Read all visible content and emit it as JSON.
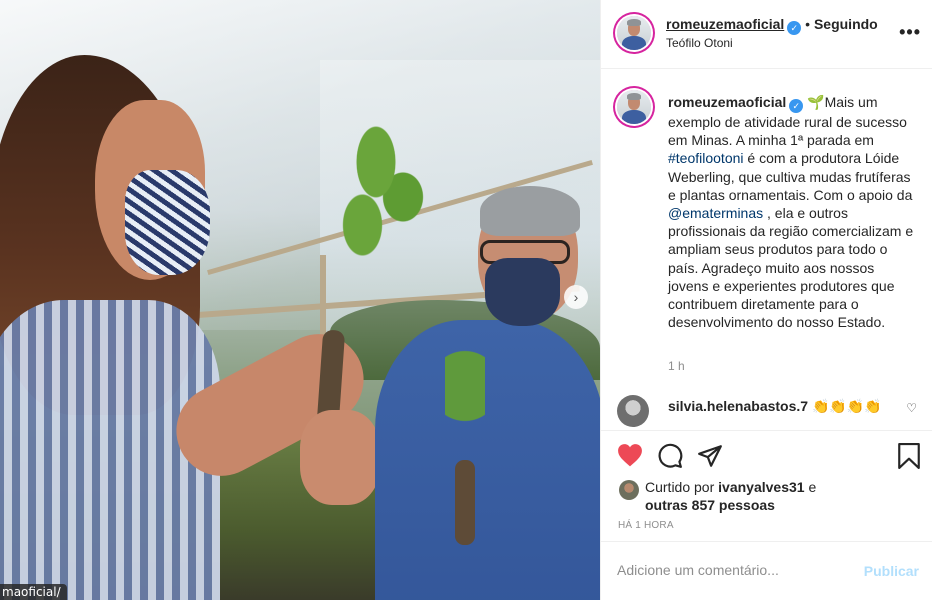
{
  "photo": {
    "url_overlay": "maoficial/"
  },
  "header": {
    "username": "romeuzemaoficial",
    "separator": "•",
    "following": "Seguindo",
    "location": "Teófilo Otoni",
    "more_icon": "more-horizontal-icon"
  },
  "caption": {
    "username": "romeuzemaoficial",
    "emoji": "🌱",
    "text_1": "Mais um exemplo de atividade rural de sucesso em Minas. A minha 1ª parada em ",
    "hashtag": "#teofilootoni",
    "text_2": " é com a produtora Lóide Weberling, que cultiva mudas frutíferas e plantas ornamentais. Com o apoio da ",
    "mention": "@ematerminas",
    "text_3": " , ela e outros profissionais da região comercializam e ampliam seus produtos para todo o país. Agradeço muito aos nossos jovens e experientes produtores que contribuem diretamente para o desenvolvimento do nosso Estado.",
    "time": "1 h"
  },
  "comment": {
    "username": "silvia.helenabastos.7",
    "text": "👏👏👏👏"
  },
  "actions": {
    "liked_prefix": "Curtido por ",
    "liked_user": "ivanyalves31",
    "liked_and": " e",
    "liked_others": "outras 857 pessoas",
    "ago": "HÁ 1 HORA"
  },
  "add_comment": {
    "placeholder": "Adicione um comentário...",
    "publish": "Publicar"
  },
  "colors": {
    "like_red": "#ed4956",
    "link_blue": "#00376b",
    "publish_disabled": "#b2dffc",
    "verified_blue": "#3897f0"
  }
}
